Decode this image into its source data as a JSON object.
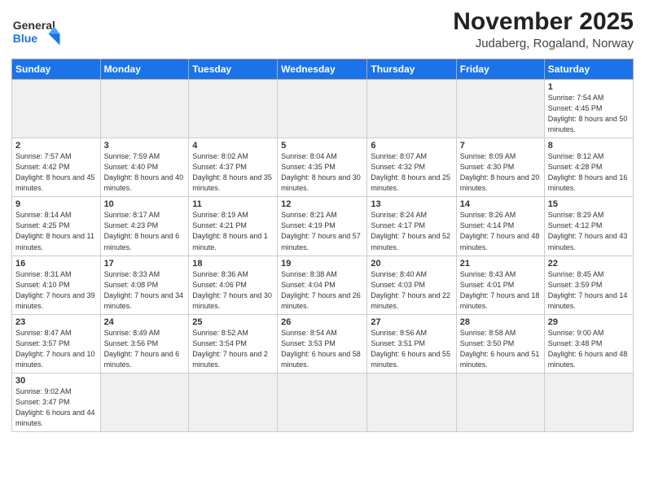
{
  "header": {
    "logo_general": "General",
    "logo_blue": "Blue",
    "main_title": "November 2025",
    "sub_title": "Judaberg, Rogaland, Norway"
  },
  "days_of_week": [
    "Sunday",
    "Monday",
    "Tuesday",
    "Wednesday",
    "Thursday",
    "Friday",
    "Saturday"
  ],
  "weeks": [
    [
      {
        "day": "",
        "empty": true
      },
      {
        "day": "",
        "empty": true
      },
      {
        "day": "",
        "empty": true
      },
      {
        "day": "",
        "empty": true
      },
      {
        "day": "",
        "empty": true
      },
      {
        "day": "",
        "empty": true
      },
      {
        "day": "1",
        "sunrise": "Sunrise: 7:54 AM",
        "sunset": "Sunset: 4:45 PM",
        "daylight": "Daylight: 8 hours and 50 minutes."
      }
    ],
    [
      {
        "day": "2",
        "sunrise": "Sunrise: 7:57 AM",
        "sunset": "Sunset: 4:42 PM",
        "daylight": "Daylight: 8 hours and 45 minutes."
      },
      {
        "day": "3",
        "sunrise": "Sunrise: 7:59 AM",
        "sunset": "Sunset: 4:40 PM",
        "daylight": "Daylight: 8 hours and 40 minutes."
      },
      {
        "day": "4",
        "sunrise": "Sunrise: 8:02 AM",
        "sunset": "Sunset: 4:37 PM",
        "daylight": "Daylight: 8 hours and 35 minutes."
      },
      {
        "day": "5",
        "sunrise": "Sunrise: 8:04 AM",
        "sunset": "Sunset: 4:35 PM",
        "daylight": "Daylight: 8 hours and 30 minutes."
      },
      {
        "day": "6",
        "sunrise": "Sunrise: 8:07 AM",
        "sunset": "Sunset: 4:32 PM",
        "daylight": "Daylight: 8 hours and 25 minutes."
      },
      {
        "day": "7",
        "sunrise": "Sunrise: 8:09 AM",
        "sunset": "Sunset: 4:30 PM",
        "daylight": "Daylight: 8 hours and 20 minutes."
      },
      {
        "day": "8",
        "sunrise": "Sunrise: 8:12 AM",
        "sunset": "Sunset: 4:28 PM",
        "daylight": "Daylight: 8 hours and 16 minutes."
      }
    ],
    [
      {
        "day": "9",
        "sunrise": "Sunrise: 8:14 AM",
        "sunset": "Sunset: 4:25 PM",
        "daylight": "Daylight: 8 hours and 11 minutes."
      },
      {
        "day": "10",
        "sunrise": "Sunrise: 8:17 AM",
        "sunset": "Sunset: 4:23 PM",
        "daylight": "Daylight: 8 hours and 6 minutes."
      },
      {
        "day": "11",
        "sunrise": "Sunrise: 8:19 AM",
        "sunset": "Sunset: 4:21 PM",
        "daylight": "Daylight: 8 hours and 1 minute."
      },
      {
        "day": "12",
        "sunrise": "Sunrise: 8:21 AM",
        "sunset": "Sunset: 4:19 PM",
        "daylight": "Daylight: 7 hours and 57 minutes."
      },
      {
        "day": "13",
        "sunrise": "Sunrise: 8:24 AM",
        "sunset": "Sunset: 4:17 PM",
        "daylight": "Daylight: 7 hours and 52 minutes."
      },
      {
        "day": "14",
        "sunrise": "Sunrise: 8:26 AM",
        "sunset": "Sunset: 4:14 PM",
        "daylight": "Daylight: 7 hours and 48 minutes."
      },
      {
        "day": "15",
        "sunrise": "Sunrise: 8:29 AM",
        "sunset": "Sunset: 4:12 PM",
        "daylight": "Daylight: 7 hours and 43 minutes."
      }
    ],
    [
      {
        "day": "16",
        "sunrise": "Sunrise: 8:31 AM",
        "sunset": "Sunset: 4:10 PM",
        "daylight": "Daylight: 7 hours and 39 minutes."
      },
      {
        "day": "17",
        "sunrise": "Sunrise: 8:33 AM",
        "sunset": "Sunset: 4:08 PM",
        "daylight": "Daylight: 7 hours and 34 minutes."
      },
      {
        "day": "18",
        "sunrise": "Sunrise: 8:36 AM",
        "sunset": "Sunset: 4:06 PM",
        "daylight": "Daylight: 7 hours and 30 minutes."
      },
      {
        "day": "19",
        "sunrise": "Sunrise: 8:38 AM",
        "sunset": "Sunset: 4:04 PM",
        "daylight": "Daylight: 7 hours and 26 minutes."
      },
      {
        "day": "20",
        "sunrise": "Sunrise: 8:40 AM",
        "sunset": "Sunset: 4:03 PM",
        "daylight": "Daylight: 7 hours and 22 minutes."
      },
      {
        "day": "21",
        "sunrise": "Sunrise: 8:43 AM",
        "sunset": "Sunset: 4:01 PM",
        "daylight": "Daylight: 7 hours and 18 minutes."
      },
      {
        "day": "22",
        "sunrise": "Sunrise: 8:45 AM",
        "sunset": "Sunset: 3:59 PM",
        "daylight": "Daylight: 7 hours and 14 minutes."
      }
    ],
    [
      {
        "day": "23",
        "sunrise": "Sunrise: 8:47 AM",
        "sunset": "Sunset: 3:57 PM",
        "daylight": "Daylight: 7 hours and 10 minutes."
      },
      {
        "day": "24",
        "sunrise": "Sunrise: 8:49 AM",
        "sunset": "Sunset: 3:56 PM",
        "daylight": "Daylight: 7 hours and 6 minutes."
      },
      {
        "day": "25",
        "sunrise": "Sunrise: 8:52 AM",
        "sunset": "Sunset: 3:54 PM",
        "daylight": "Daylight: 7 hours and 2 minutes."
      },
      {
        "day": "26",
        "sunrise": "Sunrise: 8:54 AM",
        "sunset": "Sunset: 3:53 PM",
        "daylight": "Daylight: 6 hours and 58 minutes."
      },
      {
        "day": "27",
        "sunrise": "Sunrise: 8:56 AM",
        "sunset": "Sunset: 3:51 PM",
        "daylight": "Daylight: 6 hours and 55 minutes."
      },
      {
        "day": "28",
        "sunrise": "Sunrise: 8:58 AM",
        "sunset": "Sunset: 3:50 PM",
        "daylight": "Daylight: 6 hours and 51 minutes."
      },
      {
        "day": "29",
        "sunrise": "Sunrise: 9:00 AM",
        "sunset": "Sunset: 3:48 PM",
        "daylight": "Daylight: 6 hours and 48 minutes."
      }
    ],
    [
      {
        "day": "30",
        "sunrise": "Sunrise: 9:02 AM",
        "sunset": "Sunset: 3:47 PM",
        "daylight": "Daylight: 6 hours and 44 minutes."
      },
      {
        "day": "",
        "empty": true,
        "last": true
      },
      {
        "day": "",
        "empty": true,
        "last": true
      },
      {
        "day": "",
        "empty": true,
        "last": true
      },
      {
        "day": "",
        "empty": true,
        "last": true
      },
      {
        "day": "",
        "empty": true,
        "last": true
      },
      {
        "day": "",
        "empty": true,
        "last": true
      }
    ]
  ]
}
